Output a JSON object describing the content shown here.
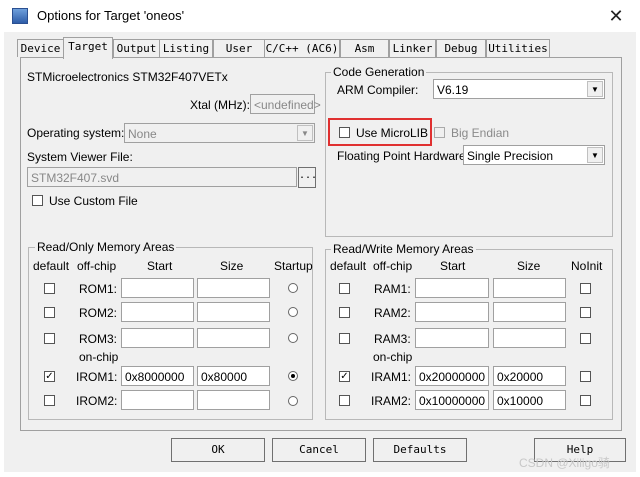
{
  "window": {
    "title": "Options for Target 'oneos'"
  },
  "tabs": [
    "Device",
    "Target",
    "Output",
    "Listing",
    "User",
    "C/C++ (AC6)",
    "Asm",
    "Linker",
    "Debug",
    "Utilities"
  ],
  "device": {
    "name": "STMicroelectronics STM32F407VETx",
    "xtal_label": "Xtal (MHz):",
    "xtal_value": "<undefined>",
    "os_label": "Operating system:",
    "os_value": "None",
    "svd_label": "System Viewer File:",
    "svd_value": "STM32F407.svd",
    "browse_label": "...",
    "custom_file_label": "Use Custom File"
  },
  "codegen": {
    "group_title": "Code Generation",
    "compiler_label": "ARM Compiler:",
    "compiler_value": "V6.19",
    "microlib_label": "Use MicroLIB",
    "big_endian_label": "Big Endian",
    "fp_label": "Floating Point Hardware:",
    "fp_value": "Single Precision"
  },
  "ro_memory": {
    "group_title": "Read/Only Memory Areas",
    "headers": {
      "default": "default",
      "offchip": "off-chip",
      "start": "Start",
      "size": "Size",
      "startup": "Startup"
    },
    "onchip_label": "on-chip",
    "rows": [
      {
        "label": "ROM1:",
        "start": "",
        "size": ""
      },
      {
        "label": "ROM2:",
        "start": "",
        "size": ""
      },
      {
        "label": "ROM3:",
        "start": "",
        "size": ""
      },
      {
        "label": "IROM1:",
        "start": "0x8000000",
        "size": "0x80000"
      },
      {
        "label": "IROM2:",
        "start": "",
        "size": ""
      }
    ]
  },
  "rw_memory": {
    "group_title": "Read/Write Memory Areas",
    "headers": {
      "default": "default",
      "offchip": "off-chip",
      "start": "Start",
      "size": "Size",
      "noinit": "NoInit"
    },
    "onchip_label": "on-chip",
    "rows": [
      {
        "label": "RAM1:",
        "start": "",
        "size": ""
      },
      {
        "label": "RAM2:",
        "start": "",
        "size": ""
      },
      {
        "label": "RAM3:",
        "start": "",
        "size": ""
      },
      {
        "label": "IRAM1:",
        "start": "0x20000000",
        "size": "0x20000"
      },
      {
        "label": "IRAM2:",
        "start": "0x10000000",
        "size": "0x10000"
      }
    ]
  },
  "buttons": {
    "ok": "OK",
    "cancel": "Cancel",
    "defaults": "Defaults",
    "help": "Help"
  },
  "checkmark": "✓",
  "watermark": "CSDN @Xiligo骑"
}
